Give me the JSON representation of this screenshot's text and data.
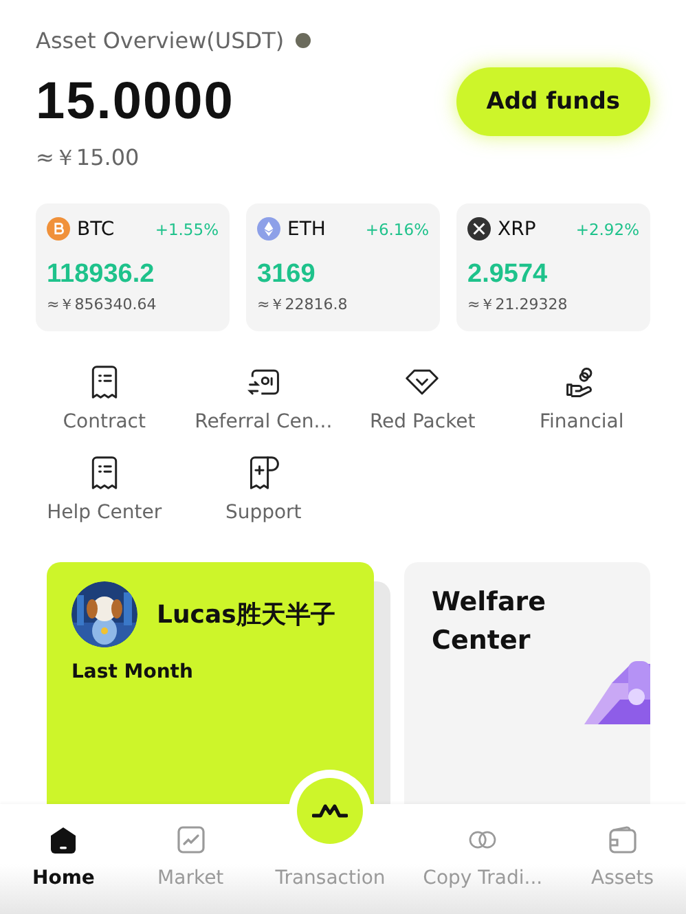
{
  "header": {
    "title": "Asset Overview(USDT)",
    "balance": "15.0000",
    "fiat": "≈￥15.00",
    "button": "Add funds"
  },
  "coins": [
    {
      "kind": "btc",
      "symbol": "BTC",
      "change": "+1.55%",
      "price": "118936.2",
      "fiat": "≈￥856340.64"
    },
    {
      "kind": "eth",
      "symbol": "ETH",
      "change": "+6.16%",
      "price": "3169",
      "fiat": "≈￥22816.8"
    },
    {
      "kind": "xrp",
      "symbol": "XRP",
      "change": "+2.92%",
      "price": "2.9574",
      "fiat": "≈￥21.29328"
    }
  ],
  "shortcuts": [
    {
      "kind": "receipt",
      "label": "Contract"
    },
    {
      "kind": "referral",
      "label": "Referral Cen..."
    },
    {
      "kind": "diamond",
      "label": "Red Packet"
    },
    {
      "kind": "hand",
      "label": "Financial"
    },
    {
      "kind": "receipt",
      "label": "Help Center"
    },
    {
      "kind": "support",
      "label": "Support"
    }
  ],
  "promo": {
    "name": "Lucas胜天半子",
    "period": "Last Month",
    "welfare": "Welfare Center"
  },
  "nav": [
    {
      "kind": "home",
      "label": "Home",
      "selected": true
    },
    {
      "kind": "market",
      "label": "Market",
      "selected": false
    },
    {
      "kind": "trade",
      "label": "Transaction",
      "selected": false
    },
    {
      "kind": "copy",
      "label": "Copy Tradi...",
      "selected": false
    },
    {
      "kind": "assets",
      "label": "Assets",
      "selected": false
    }
  ]
}
